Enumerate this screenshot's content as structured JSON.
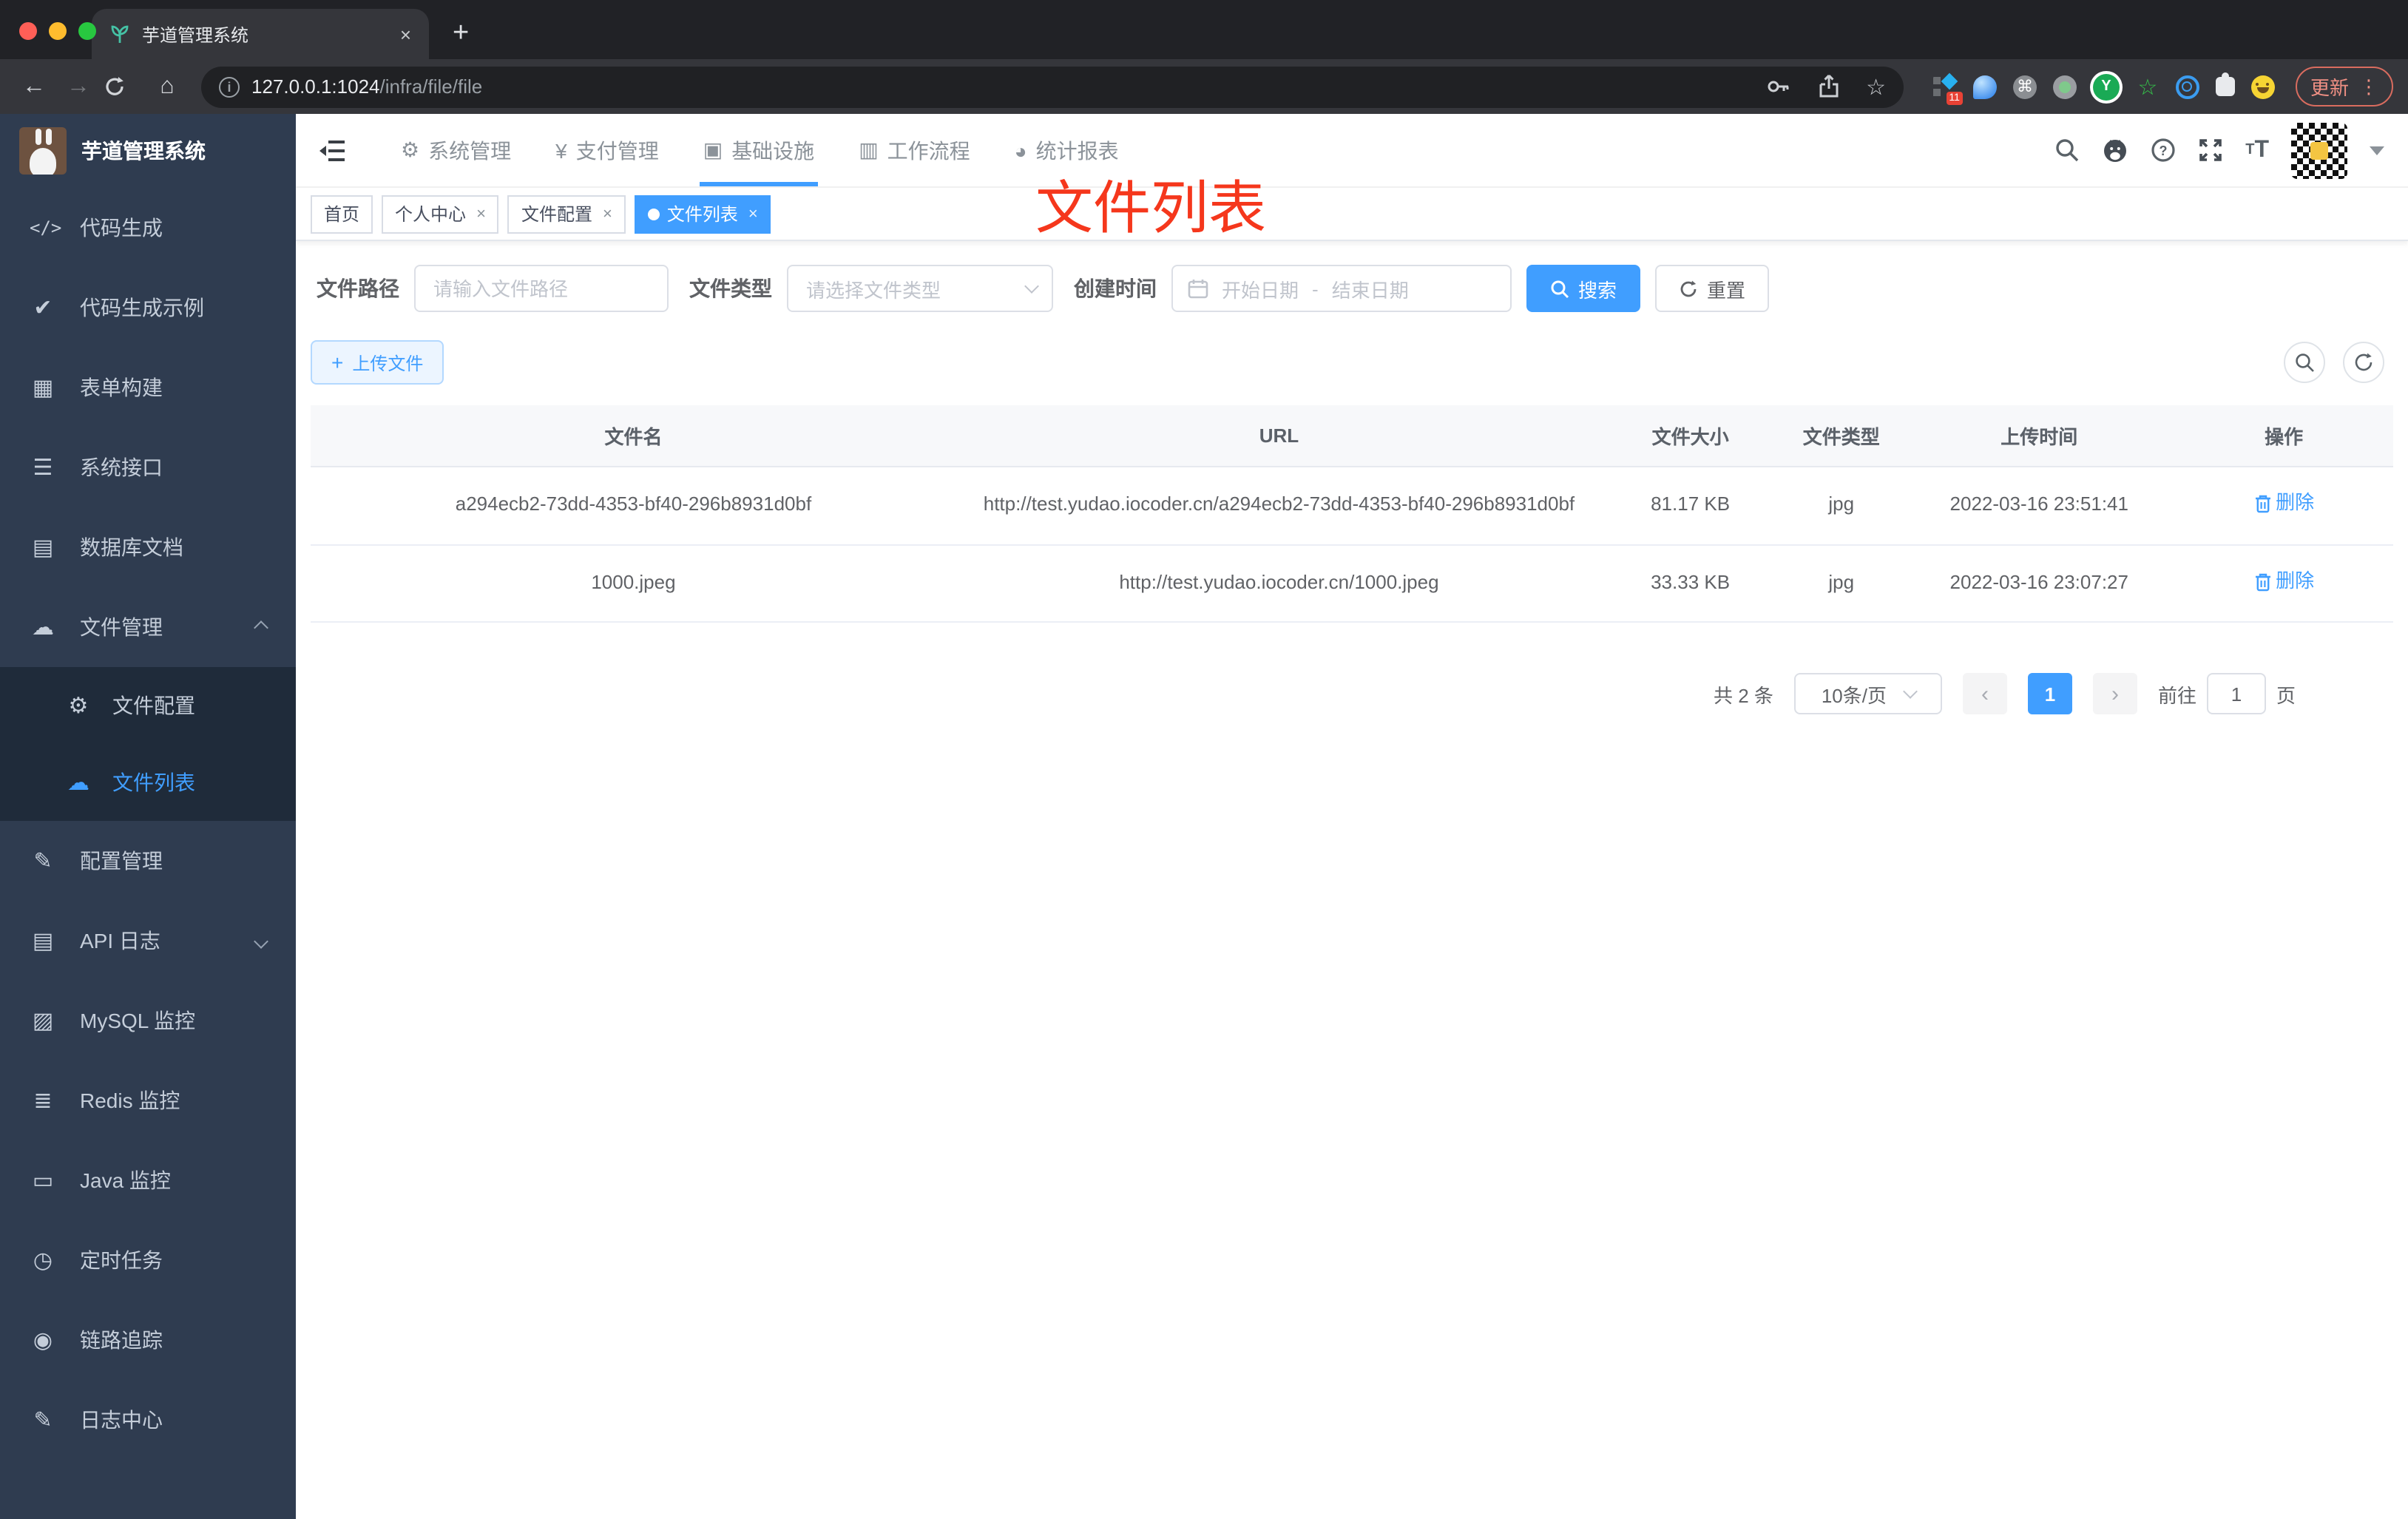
{
  "colors": {
    "accent": "#409eff",
    "annotation_red": "#f5371c",
    "sidebar_bg": "#2f3c50",
    "submenu_bg": "#1f2b3a"
  },
  "browser": {
    "tab_title": "芋道管理系统",
    "new_tab": "+",
    "close": "×",
    "url_host": "127.0.0.1:1024",
    "url_path": "/infra/file/file",
    "info_glyph": "i",
    "ext_badge": "11",
    "cmd_glyph": "⌘",
    "y_glyph": "Y",
    "star_glyph": "☆",
    "update_label": "更新",
    "menu_dots": "⋮"
  },
  "sidebar": {
    "logo_title": "芋道管理系统",
    "items": [
      {
        "label": "代码生成"
      },
      {
        "label": "代码生成示例"
      },
      {
        "label": "表单构建"
      },
      {
        "label": "系统接口"
      },
      {
        "label": "数据库文档"
      },
      {
        "label": "文件管理"
      },
      {
        "label": "配置管理"
      },
      {
        "label": "API 日志"
      },
      {
        "label": "MySQL 监控"
      },
      {
        "label": "Redis 监控"
      },
      {
        "label": "Java 监控"
      },
      {
        "label": "定时任务"
      },
      {
        "label": "链路追踪"
      },
      {
        "label": "日志中心"
      }
    ],
    "sub": [
      {
        "label": "文件配置"
      },
      {
        "label": "文件列表"
      }
    ]
  },
  "topnav": {
    "items": [
      {
        "label": "系统管理"
      },
      {
        "label": "支付管理"
      },
      {
        "label": "基础设施"
      },
      {
        "label": "工作流程"
      },
      {
        "label": "统计报表"
      }
    ]
  },
  "tags": [
    {
      "label": "首页"
    },
    {
      "label": "个人中心"
    },
    {
      "label": "文件配置"
    },
    {
      "label": "文件列表"
    }
  ],
  "annotation": {
    "text": "文件列表"
  },
  "filters": {
    "path_label": "文件路径",
    "path_placeholder": "请输入文件路径",
    "type_label": "文件类型",
    "type_placeholder": "请选择文件类型",
    "date_label": "创建时间",
    "date_start": "开始日期",
    "date_sep": "-",
    "date_end": "结束日期",
    "search_label": "搜索",
    "reset_label": "重置"
  },
  "toolbar": {
    "upload_label": "上传文件",
    "plus": "+"
  },
  "table": {
    "headers": [
      "文件名",
      "URL",
      "文件大小",
      "文件类型",
      "上传时间",
      "操作"
    ],
    "rows": [
      {
        "name": "a294ecb2-73dd-4353-bf40-296b8931d0bf",
        "url": "http://test.yudao.iocoder.cn/a294ecb2-73dd-4353-bf40-296b8931d0bf",
        "size": "81.17 KB",
        "type": "jpg",
        "time": "2022-03-16 23:51:41",
        "action": "删除"
      },
      {
        "name": "1000.jpeg",
        "url": "http://test.yudao.iocoder.cn/1000.jpeg",
        "size": "33.33 KB",
        "type": "jpg",
        "time": "2022-03-16 23:07:27",
        "action": "删除"
      }
    ]
  },
  "pagination": {
    "total": "共 2 条",
    "size": "10条/页",
    "prev": "‹",
    "page": "1",
    "next": "›",
    "jump_prefix": "前往",
    "jump_value": "1",
    "jump_suffix": "页"
  },
  "icons": {
    "code": "</>",
    "shield": "✔",
    "form": "▦",
    "sliders": "☰",
    "db": "▤",
    "cloud": "☁",
    "gear": "⚙",
    "edit": "✎",
    "doc": "▤",
    "chart": "▨",
    "layers": "≣",
    "monitor": "▭",
    "timer": "◷",
    "eye": "◉",
    "nav_gear": "⚙",
    "yen": "¥",
    "infra": "▣",
    "work": "▥",
    "stats": "◕",
    "back": "←",
    "forward": "→",
    "home": "⌂"
  }
}
